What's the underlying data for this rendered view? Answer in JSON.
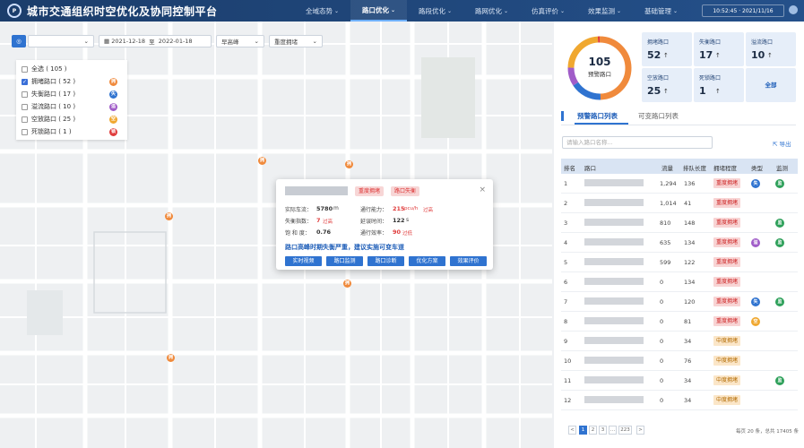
{
  "header": {
    "title": "城市交通组织时空优化及协同控制平台",
    "logo": "logo-icon",
    "nav": [
      {
        "label": "全域态势"
      },
      {
        "label": "路口优化"
      },
      {
        "label": "路段优化"
      },
      {
        "label": "路网优化"
      },
      {
        "label": "仿真评价"
      },
      {
        "label": "效果监测"
      },
      {
        "label": "基础管理"
      }
    ],
    "active_nav": "路口优化",
    "clock": "10:52:45 · 2021/11/16"
  },
  "toolbar": {
    "start_date": "2021-12-18",
    "to": "至",
    "end_date": "2022-01-18",
    "period": "早高峰",
    "level": "重度拥堵"
  },
  "legend": {
    "items": [
      {
        "label": "全选 ( 105 )",
        "checked": false,
        "badge": "",
        "color": ""
      },
      {
        "label": "拥堵路口 ( 52 )",
        "checked": true,
        "badge": "拥",
        "color": "#f08a3c"
      },
      {
        "label": "失衡路口 ( 17 )",
        "checked": false,
        "badge": "失",
        "color": "#2f73d0"
      },
      {
        "label": "溢流路口 ( 10 )",
        "checked": false,
        "badge": "溢",
        "color": "#a05cc8"
      },
      {
        "label": "空放路口 ( 25 )",
        "checked": false,
        "badge": "空",
        "color": "#f0a830"
      },
      {
        "label": "死锁路口 ( 1 )",
        "checked": false,
        "badge": "锁",
        "color": "#e03c3c"
      }
    ]
  },
  "popup": {
    "tag1": "重度拥堵",
    "tag2": "路口失衡",
    "f1_label": "实际车流：",
    "f1_value": "5780",
    "f1_unit": "m",
    "f2_label": "通行能力：",
    "f2_value": "215",
    "f2_unit": "pcu/h",
    "f2_note": "过高",
    "f3_label": "失衡指数：",
    "f3_value": "7",
    "f3_note": "过高",
    "f4_label": "延误时间：",
    "f4_value": "122",
    "f4_unit": "s",
    "f5_label": "饱 和 度：",
    "f5_value": "0.76",
    "f6_label": "通行效率：",
    "f6_value": "90",
    "f6_note": "过低",
    "warning": "路口高峰时期失衡严重，建议实施可变车道",
    "buttons": [
      "实时视频",
      "路口监测",
      "路口诊断",
      "优化方案",
      "效果评价"
    ]
  },
  "summary": {
    "total": "105",
    "total_label": "预警路口",
    "donut": [
      {
        "value": 52,
        "color": "#f08a3c"
      },
      {
        "value": 17,
        "color": "#2f73d0"
      },
      {
        "value": 10,
        "color": "#a05cc8"
      },
      {
        "value": 25,
        "color": "#f0a830"
      },
      {
        "value": 1,
        "color": "#e03c3c"
      }
    ],
    "stats": [
      {
        "label": "拥堵路口",
        "value": "52",
        "arrow": "↑"
      },
      {
        "label": "失衡路口",
        "value": "17",
        "arrow": "↑"
      },
      {
        "label": "溢流路口",
        "value": "10",
        "arrow": "↑"
      },
      {
        "label": "空放路口",
        "value": "25",
        "arrow": "↑"
      },
      {
        "label": "死锁路口",
        "value": "1",
        "arrow": "↑"
      }
    ],
    "all": "全部"
  },
  "tabs": [
    "预警路口列表",
    "可变路口列表"
  ],
  "search_placeholder": "请输入路口名称...",
  "export": "导出",
  "table": {
    "headers": [
      "排名",
      "路口",
      "流量",
      "排队长度",
      "拥堵程度",
      "类型",
      "监测"
    ],
    "rows": [
      {
        "rank": "1",
        "flow": "1,294",
        "queue": "136",
        "level": "重度拥堵",
        "types": [
          "失"
        ],
        "monitor": true
      },
      {
        "rank": "2",
        "flow": "1,014",
        "queue": "41",
        "level": "重度拥堵",
        "types": [],
        "monitor": false
      },
      {
        "rank": "3",
        "flow": "810",
        "queue": "148",
        "level": "重度拥堵",
        "types": [],
        "monitor": true
      },
      {
        "rank": "4",
        "flow": "635",
        "queue": "134",
        "level": "重度拥堵",
        "types": [
          "溢"
        ],
        "monitor": true
      },
      {
        "rank": "5",
        "flow": "599",
        "queue": "122",
        "level": "重度拥堵",
        "types": [],
        "monitor": false
      },
      {
        "rank": "6",
        "flow": "0",
        "queue": "134",
        "level": "重度拥堵",
        "types": [],
        "monitor": false
      },
      {
        "rank": "7",
        "flow": "0",
        "queue": "120",
        "level": "重度拥堵",
        "types": [
          "失"
        ],
        "monitor": true
      },
      {
        "rank": "8",
        "flow": "0",
        "queue": "81",
        "level": "重度拥堵",
        "types": [
          "空"
        ],
        "monitor": false
      },
      {
        "rank": "9",
        "flow": "0",
        "queue": "34",
        "level": "中度拥堵",
        "types": [],
        "monitor": false
      },
      {
        "rank": "10",
        "flow": "0",
        "queue": "76",
        "level": "中度拥堵",
        "types": [],
        "monitor": false
      },
      {
        "rank": "11",
        "flow": "0",
        "queue": "34",
        "level": "中度拥堵",
        "types": [],
        "monitor": true
      },
      {
        "rank": "12",
        "flow": "0",
        "queue": "34",
        "level": "中度拥堵",
        "types": [],
        "monitor": false
      }
    ]
  },
  "pagination": {
    "pages": [
      "1",
      "2",
      "3",
      "…",
      "223"
    ],
    "prev": "<",
    "next": ">",
    "info": "每页 20 条，总共 17405 条"
  }
}
